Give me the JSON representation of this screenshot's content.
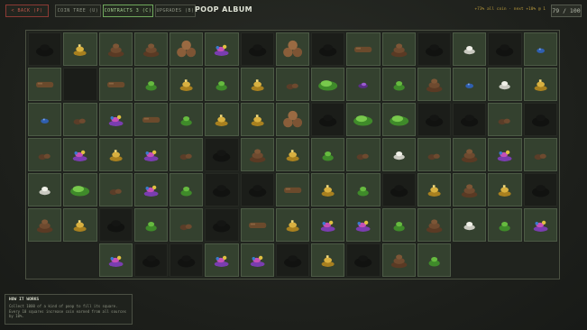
{
  "header": {
    "back_label": "< BACK  (P)",
    "tabs": [
      {
        "label": "COIN TREE  (U)",
        "active": false
      },
      {
        "label": "CONTRACTS  3  (C)",
        "active": true
      },
      {
        "label": "UPGRADES  (B)",
        "active": false
      }
    ],
    "title": "POOP ALBUM",
    "rate_text": "+73% all coin · next +10% @ 1",
    "count": "79 / 100"
  },
  "info": {
    "title": "HOW IT WORKS",
    "text": "Collect 1000 of a kind of poop to fill its square. Every 10 squares increase coin earned from all sources by 10%."
  },
  "colors": {
    "cell_found": "#34412f",
    "cell_locked": "#1b1d19",
    "brown": "#6e4a2f",
    "gold": "#c9a23a",
    "green": "#5aa836",
    "purple": "#7a3db0"
  },
  "album": {
    "rows": [
      [
        {
          "s": "locked",
          "p": "big"
        },
        {
          "s": "found",
          "p": "gold"
        },
        {
          "s": "found",
          "p": "pile"
        },
        {
          "s": "found",
          "p": "pile"
        },
        {
          "s": "found",
          "p": "triple"
        },
        {
          "s": "found",
          "p": "rainbow"
        },
        {
          "s": "locked",
          "p": "big"
        },
        {
          "s": "found",
          "p": "triple"
        },
        {
          "s": "locked",
          "p": "big"
        },
        {
          "s": "found",
          "p": "log"
        },
        {
          "s": "found",
          "p": "pile"
        },
        {
          "s": "locked",
          "p": "big"
        },
        {
          "s": "found",
          "p": "white"
        },
        {
          "s": "locked",
          "p": "big"
        },
        {
          "s": "found",
          "p": "blue"
        }
      ],
      [
        {
          "s": "found",
          "p": "log"
        },
        {
          "s": "locked",
          "p": "none"
        },
        {
          "s": "found",
          "p": "log"
        },
        {
          "s": "found",
          "p": "green"
        },
        {
          "s": "found",
          "p": "gold"
        },
        {
          "s": "found",
          "p": "green"
        },
        {
          "s": "found",
          "p": "gold"
        },
        {
          "s": "found",
          "p": "brownsmall"
        },
        {
          "s": "found",
          "p": "greenbig"
        },
        {
          "s": "found",
          "p": "purple"
        },
        {
          "s": "found",
          "p": "green"
        },
        {
          "s": "found",
          "p": "pile"
        },
        {
          "s": "found",
          "p": "blue"
        },
        {
          "s": "found",
          "p": "white"
        },
        {
          "s": "found",
          "p": "gold"
        }
      ],
      [
        {
          "s": "found",
          "p": "blue"
        },
        {
          "s": "found",
          "p": "brownsmall"
        },
        {
          "s": "found",
          "p": "rainbow"
        },
        {
          "s": "found",
          "p": "log"
        },
        {
          "s": "found",
          "p": "green"
        },
        {
          "s": "found",
          "p": "gold"
        },
        {
          "s": "found",
          "p": "gold"
        },
        {
          "s": "found",
          "p": "triple"
        },
        {
          "s": "locked",
          "p": "big"
        },
        {
          "s": "found",
          "p": "greenbig"
        },
        {
          "s": "found",
          "p": "greenbig"
        },
        {
          "s": "locked",
          "p": "big"
        },
        {
          "s": "locked",
          "p": "big"
        },
        {
          "s": "found",
          "p": "brownsmall"
        },
        {
          "s": "locked",
          "p": "big"
        }
      ],
      [
        {
          "s": "found",
          "p": "brownsmall"
        },
        {
          "s": "found",
          "p": "rainbow"
        },
        {
          "s": "found",
          "p": "gold"
        },
        {
          "s": "found",
          "p": "rainbow"
        },
        {
          "s": "found",
          "p": "brownsmall"
        },
        {
          "s": "locked",
          "p": "big"
        },
        {
          "s": "found",
          "p": "pile"
        },
        {
          "s": "found",
          "p": "gold"
        },
        {
          "s": "found",
          "p": "green"
        },
        {
          "s": "found",
          "p": "brownsmall"
        },
        {
          "s": "found",
          "p": "white"
        },
        {
          "s": "found",
          "p": "brownsmall"
        },
        {
          "s": "found",
          "p": "pile"
        },
        {
          "s": "found",
          "p": "rainbow"
        },
        {
          "s": "found",
          "p": "brownsmall"
        }
      ],
      [
        {
          "s": "found",
          "p": "white"
        },
        {
          "s": "found",
          "p": "greenbig"
        },
        {
          "s": "found",
          "p": "brownsmall"
        },
        {
          "s": "found",
          "p": "rainbow"
        },
        {
          "s": "found",
          "p": "green"
        },
        {
          "s": "locked",
          "p": "big"
        },
        {
          "s": "locked",
          "p": "big"
        },
        {
          "s": "found",
          "p": "log"
        },
        {
          "s": "found",
          "p": "gold"
        },
        {
          "s": "found",
          "p": "green"
        },
        {
          "s": "locked",
          "p": "big"
        },
        {
          "s": "found",
          "p": "gold"
        },
        {
          "s": "found",
          "p": "pile"
        },
        {
          "s": "found",
          "p": "gold"
        },
        {
          "s": "locked",
          "p": "big"
        }
      ],
      [
        {
          "s": "found",
          "p": "pile"
        },
        {
          "s": "found",
          "p": "gold"
        },
        {
          "s": "locked",
          "p": "big"
        },
        {
          "s": "found",
          "p": "green"
        },
        {
          "s": "found",
          "p": "brownsmall"
        },
        {
          "s": "locked",
          "p": "big"
        },
        {
          "s": "found",
          "p": "log"
        },
        {
          "s": "found",
          "p": "gold"
        },
        {
          "s": "found",
          "p": "rainbow"
        },
        {
          "s": "found",
          "p": "rainbow"
        },
        {
          "s": "found",
          "p": "green"
        },
        {
          "s": "found",
          "p": "pile"
        },
        {
          "s": "found",
          "p": "white"
        },
        {
          "s": "found",
          "p": "green"
        },
        {
          "s": "found",
          "p": "rainbow"
        }
      ],
      [
        {
          "s": "empty",
          "p": "none"
        },
        {
          "s": "empty",
          "p": "none"
        },
        {
          "s": "found",
          "p": "rainbow"
        },
        {
          "s": "locked",
          "p": "big"
        },
        {
          "s": "locked",
          "p": "big"
        },
        {
          "s": "found",
          "p": "rainbow"
        },
        {
          "s": "found",
          "p": "rainbow"
        },
        {
          "s": "locked",
          "p": "big"
        },
        {
          "s": "found",
          "p": "gold"
        },
        {
          "s": "locked",
          "p": "big"
        },
        {
          "s": "found",
          "p": "pile"
        },
        {
          "s": "found",
          "p": "green"
        },
        {
          "s": "empty",
          "p": "none"
        },
        {
          "s": "empty",
          "p": "none"
        },
        {
          "s": "empty",
          "p": "none"
        }
      ]
    ]
  }
}
